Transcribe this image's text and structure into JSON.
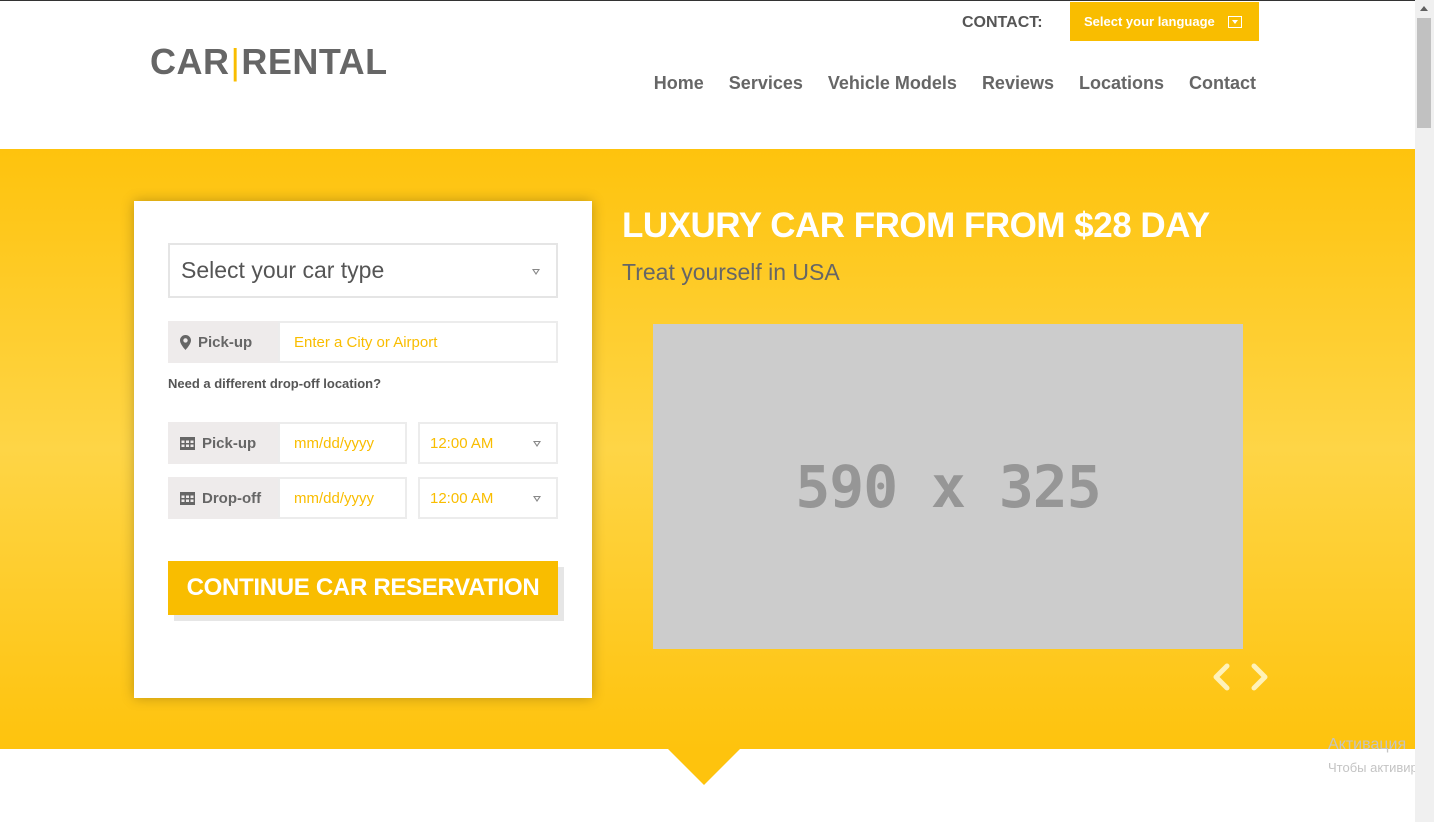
{
  "header": {
    "logo_left": "CAR",
    "logo_sep": "|",
    "logo_right": "RENTAL",
    "contact_label": "CONTACT:",
    "language_button": "Select your language"
  },
  "nav": {
    "items": [
      "Home",
      "Services",
      "Vehicle Models",
      "Reviews",
      "Locations",
      "Contact"
    ]
  },
  "form": {
    "car_type_select": "Select your car type",
    "pickup_label": "Pick-up",
    "pickup_placeholder": "Enter a City or Airport",
    "dropoff_link": "Need a different drop-off location?",
    "pickup_date_label": "Pick-up",
    "pickup_date_placeholder": "mm/dd/yyyy",
    "pickup_time": "12:00 AM",
    "dropoff_date_label": "Drop-off",
    "dropoff_date_placeholder": "mm/dd/yyyy",
    "dropoff_time": "12:00 AM",
    "continue_button": "CONTINUE CAR RESERVATION"
  },
  "promo": {
    "title": "LUXURY CAR FROM FROM $28 DAY",
    "subtitle": "Treat yourself in USA",
    "image_placeholder": "590 x 325"
  },
  "watermark": {
    "line1": "Активация",
    "line2": "Чтобы активир"
  },
  "icons": {
    "map_pin": "map-pin-icon",
    "calendar": "calendar-icon",
    "chevron_left": "chevron-left-icon",
    "chevron_right": "chevron-right-icon"
  },
  "colors": {
    "accent": "#f9bd00",
    "text_gray": "#666666",
    "placeholder_bg": "#cccccc"
  }
}
